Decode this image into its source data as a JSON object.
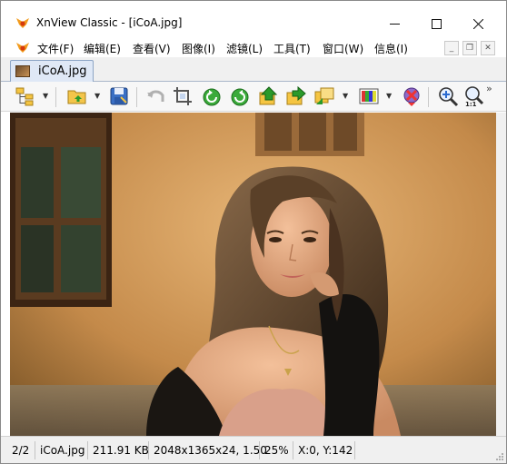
{
  "window": {
    "title": "XnView Classic - [iCoA.jpg]",
    "min_glyph": "—",
    "max_glyph": "☐",
    "close_glyph": "✕"
  },
  "menu": {
    "items": [
      "文件(F)",
      "编辑(E)",
      "查看(V)",
      "图像(I)",
      "滤镜(L)",
      "工具(T)",
      "窗口(W)",
      "信息(I)"
    ],
    "mdi_min": "_",
    "mdi_restore": "❐",
    "mdi_close": "✕"
  },
  "tabs": [
    {
      "label": "iCoA.jpg"
    }
  ],
  "toolbar": {
    "icons": [
      "browser-tree-icon",
      "open-folder-icon",
      "save-disk-icon",
      "undo-icon",
      "crop-icon",
      "rotate-left-icon",
      "rotate-right-icon",
      "previous-image-icon",
      "next-image-icon",
      "slideshow-icon",
      "adjust-colors-icon",
      "close-image-icon",
      "zoom-in-icon",
      "zoom-actual-size-icon"
    ],
    "overflow_glyph": "»"
  },
  "status": {
    "index": "2/2",
    "filename": "iCoA.jpg",
    "filesize": "211.91 KB",
    "dimensions": "2048x1365x24, 1.50",
    "zoom": "25%",
    "cursor": "X:0, Y:142"
  },
  "colors": {
    "accent": "#2a8a2a",
    "tab_bg": "#dfe8f6",
    "status_bg": "#f0f0f0"
  }
}
